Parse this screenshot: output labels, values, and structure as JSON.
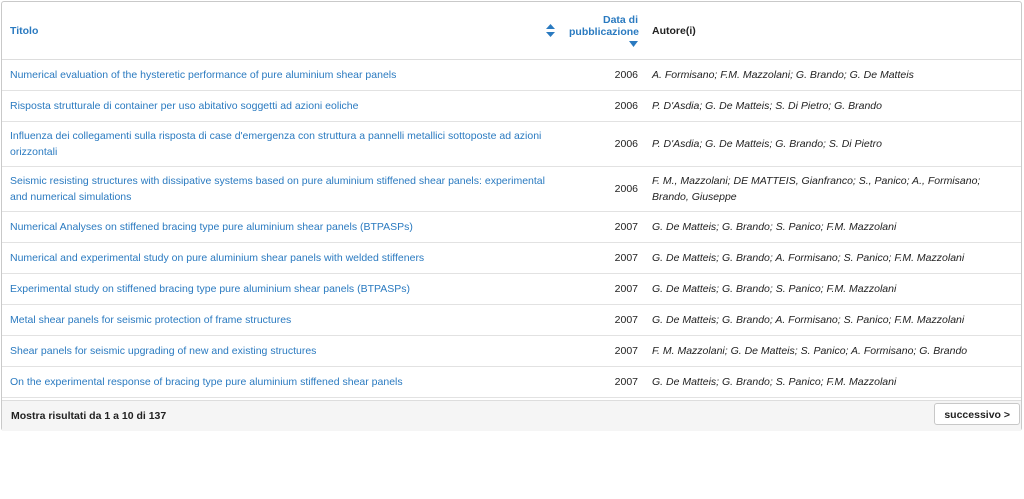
{
  "table": {
    "headers": {
      "title": "Titolo",
      "date_line1": "Data di",
      "date_line2": "pubblicazione",
      "authors": "Autore(i)"
    },
    "rows": [
      {
        "title": "Numerical evaluation of the hysteretic performance of pure aluminium shear panels",
        "date": "2006",
        "authors": "A. Formisano; F.M. Mazzolani; G. Brando; G. De Matteis"
      },
      {
        "title": "Risposta strutturale di container per uso abitativo soggetti ad azioni eoliche",
        "date": "2006",
        "authors": "P. D'Asdia; G. De Matteis; S. Di Pietro; G. Brando"
      },
      {
        "title": "Influenza dei collegamenti sulla risposta di case d'emergenza con struttura a pannelli metallici sottoposte ad azioni orizzontali",
        "date": "2006",
        "authors": "P. D'Asdia; G. De Matteis; G. Brando; S. Di Pietro"
      },
      {
        "title": "Seismic resisting structures with dissipative systems based on pure aluminium stiffened shear panels: experimental and numerical simulations",
        "date": "2006",
        "authors": "F. M., Mazzolani; DE MATTEIS, Gianfranco; S., Panico; A., Formisano; Brando, Giuseppe"
      },
      {
        "title": "Numerical Analyses on stiffened bracing type pure aluminium shear panels (BTPASPs)",
        "date": "2007",
        "authors": "G. De Matteis; G. Brando; S. Panico; F.M. Mazzolani"
      },
      {
        "title": "Numerical and experimental study on pure aluminium shear panels with welded stiffeners",
        "date": "2007",
        "authors": "G. De Matteis; G. Brando; A. Formisano; S. Panico; F.M. Mazzolani"
      },
      {
        "title": "Experimental study on stiffened bracing type pure aluminium shear panels (BTPASPs)",
        "date": "2007",
        "authors": "G. De Matteis; G. Brando; S. Panico; F.M. Mazzolani"
      },
      {
        "title": "Metal shear panels for seismic protection of frame structures",
        "date": "2007",
        "authors": "G. De Matteis; G. Brando; A. Formisano; S. Panico; F.M. Mazzolani"
      },
      {
        "title": "Shear panels for seismic upgrading of new and existing structures",
        "date": "2007",
        "authors": "F. M. Mazzolani; G. De Matteis; S. Panico; A. Formisano; G. Brando"
      },
      {
        "title": "On the experimental response of bracing type pure aluminium stiffened shear panels",
        "date": "2007",
        "authors": "G. De Matteis; G. Brando; S. Panico; F.M. Mazzolani"
      }
    ]
  },
  "footer": {
    "info": "Mostra risultati da 1 a 10 di 137",
    "next_label": "successivo >"
  },
  "colors": {
    "link": "#2a7ac0",
    "border": "#dddddd",
    "footer_bg": "#f5f5f5"
  },
  "icons": {
    "title_sort": "sort-both-icon",
    "date_sort": "sort-desc-icon"
  }
}
